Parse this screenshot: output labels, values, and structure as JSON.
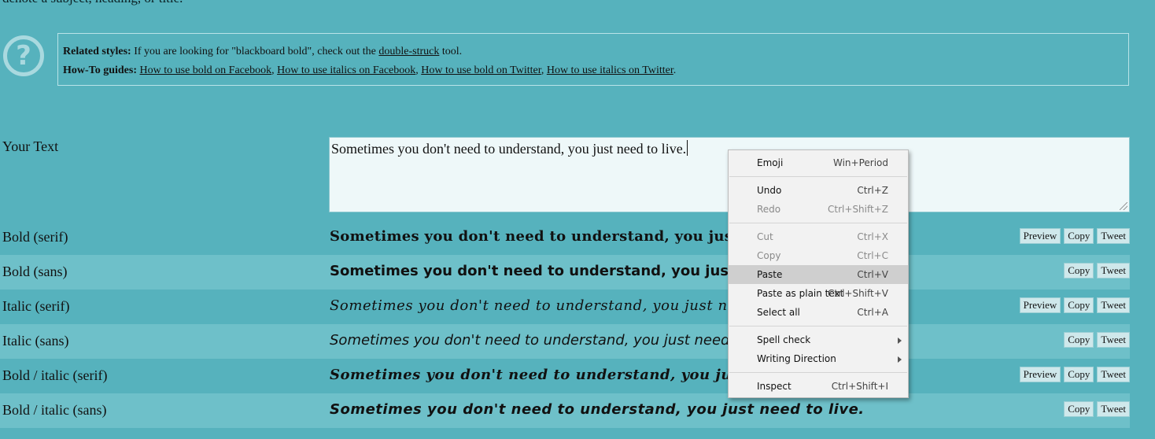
{
  "top_text": "denote a subject, heading, or title.",
  "info": {
    "related_label": "Related styles:",
    "related_text_before": " If you are looking for \"blackboard bold\", check out the ",
    "related_link": "double-struck",
    "related_text_after": " tool.",
    "howto_label": "How-To guides:",
    "howto_links": [
      "How to use bold on Facebook",
      "How to use italics on Facebook",
      "How to use bold on Twitter",
      "How to use italics on Twitter"
    ]
  },
  "input": {
    "label": "Your Text",
    "value": "Sometimes you don't need to understand, you just need to live."
  },
  "rows": [
    {
      "label": "Bold (serif)",
      "output": "Sometimes you don't need to understand, you just nee",
      "buttons": [
        "Preview",
        "Copy",
        "Tweet"
      ]
    },
    {
      "label": "Bold (sans)",
      "output": "Sometimes you don't need to understand, you just need",
      "buttons": [
        "Copy",
        "Tweet"
      ]
    },
    {
      "label": "Italic (serif)",
      "output": "Sometimes you don't need to understand, you just need",
      "buttons": [
        "Preview",
        "Copy",
        "Tweet"
      ]
    },
    {
      "label": "Italic (sans)",
      "output": "Sometimes you don't need to understand, you just need to",
      "buttons": [
        "Copy",
        "Tweet"
      ]
    },
    {
      "label": "Bold / italic (serif)",
      "output": "Sometimes you don't need to understand, you just n",
      "buttons": [
        "Preview",
        "Copy",
        "Tweet"
      ]
    },
    {
      "label": "Bold / italic (sans)",
      "output": "Sometimes you don't need to understand, you just need to live.",
      "buttons": [
        "Copy",
        "Tweet"
      ]
    }
  ],
  "context_menu": {
    "groups": [
      [
        {
          "label": "Emoji",
          "shortcut": "Win+Period",
          "state": "normal"
        }
      ],
      [
        {
          "label": "Undo",
          "shortcut": "Ctrl+Z",
          "state": "normal"
        },
        {
          "label": "Redo",
          "shortcut": "Ctrl+Shift+Z",
          "state": "disabled"
        }
      ],
      [
        {
          "label": "Cut",
          "shortcut": "Ctrl+X",
          "state": "disabled"
        },
        {
          "label": "Copy",
          "shortcut": "Ctrl+C",
          "state": "disabled"
        },
        {
          "label": "Paste",
          "shortcut": "Ctrl+V",
          "state": "highlighted"
        },
        {
          "label": "Paste as plain text",
          "shortcut": "Ctrl+Shift+V",
          "state": "normal"
        },
        {
          "label": "Select all",
          "shortcut": "Ctrl+A",
          "state": "normal"
        }
      ],
      [
        {
          "label": "Spell check",
          "shortcut": "",
          "state": "submenu"
        },
        {
          "label": "Writing Direction",
          "shortcut": "",
          "state": "submenu"
        }
      ],
      [
        {
          "label": "Inspect",
          "shortcut": "Ctrl+Shift+I",
          "state": "normal"
        }
      ]
    ]
  },
  "colors": {
    "page_bg": "#56b2bd",
    "alt_row_bg": "#6ec0c9",
    "textarea_bg": "#eef8f9",
    "menu_bg": "#f2f2f2",
    "menu_highlight": "#cfcfcf"
  }
}
